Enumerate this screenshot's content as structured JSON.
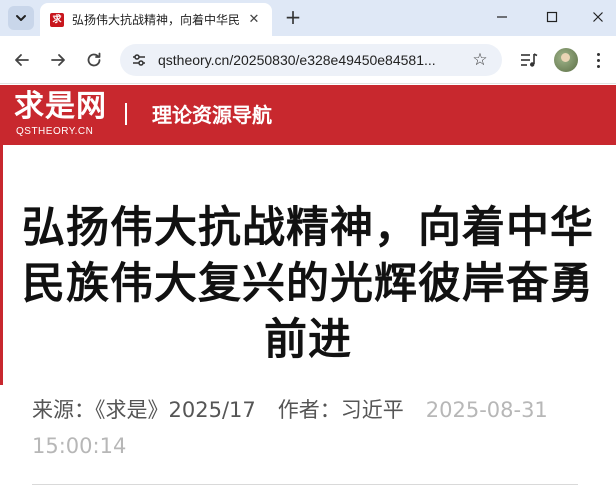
{
  "browser": {
    "tab": {
      "title": "弘扬伟大抗战精神，向着中华民",
      "favicon_text": "求",
      "close_glyph": "✕"
    },
    "new_tab_glyph": "+",
    "address": {
      "url": "qstheory.cn/20250830/e328e49450e84581..."
    },
    "star_glyph": "☆",
    "icons": {
      "tab_search": "chevron-down-icon",
      "back": "arrow-left-icon",
      "forward": "arrow-right-icon",
      "reload": "reload-icon",
      "site_info": "tune-icon",
      "bookmark": "star-icon",
      "media": "media-control-icon",
      "menu": "more-vert-icon"
    }
  },
  "site": {
    "logo_text": "求是网",
    "logo_subtext": "QSTHEORY.CN",
    "divider": "|",
    "nav_title": "理论资源导航",
    "brand_color": "#c8282e"
  },
  "article": {
    "title": "弘扬伟大抗战精神，向着中华民族伟大复兴的光辉彼岸奋勇前进",
    "source": "来源：《求是》2025/17",
    "author": "作者：习近平",
    "date": "2025-08-31",
    "time": "15:00:14"
  }
}
